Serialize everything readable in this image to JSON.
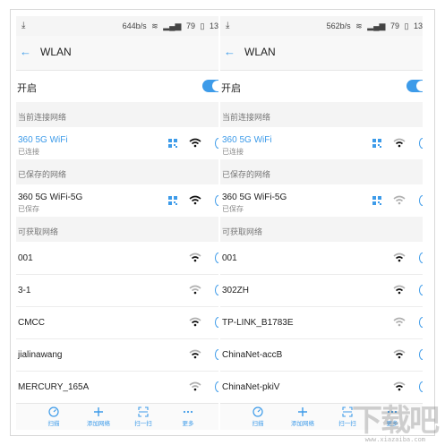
{
  "left": {
    "status": {
      "speed": "644b/s",
      "battery": "79",
      "time": "13"
    },
    "title": "WLAN",
    "toggle_label": "开启",
    "sections": {
      "connected": "当前连接网络",
      "saved": "已保存的网络",
      "available": "可获取网络"
    },
    "connected": {
      "name": "360 5G WiFi",
      "status": "已连接"
    },
    "saved": {
      "name": "360 5G WiFi-5G",
      "status": "已保存"
    },
    "available": [
      "001",
      "3-1",
      "CMCC",
      "jialinawang",
      "MERCURY_165A"
    ],
    "bottom": {
      "scan": "扫描",
      "add": "添加网络",
      "qr": "扫一扫",
      "more": "更多"
    }
  },
  "right": {
    "status": {
      "speed": "562b/s",
      "battery": "79",
      "time": "13"
    },
    "title": "WLAN",
    "toggle_label": "开启",
    "sections": {
      "connected": "当前连接网络",
      "saved": "已保存的网络",
      "available": "可获取网络"
    },
    "connected": {
      "name": "360 5G WiFi",
      "status": "已连接"
    },
    "saved": {
      "name": "360 5G WiFi-5G",
      "status": "已保存"
    },
    "available": [
      "001",
      "302ZH",
      "TP-LINK_B1783E",
      "ChinaNet-accB",
      "ChinaNet-pkiV"
    ],
    "bottom": {
      "scan": "扫描",
      "add": "添加网络",
      "qr": "扫一扫",
      "more": "更多"
    }
  },
  "watermark": {
    "logo": "下载吧",
    "url": "www.xiazaiba.com"
  },
  "colors": {
    "accent": "#3d9be9",
    "wifi_active": "#111111",
    "wifi_weak": "#b0b0b0"
  }
}
